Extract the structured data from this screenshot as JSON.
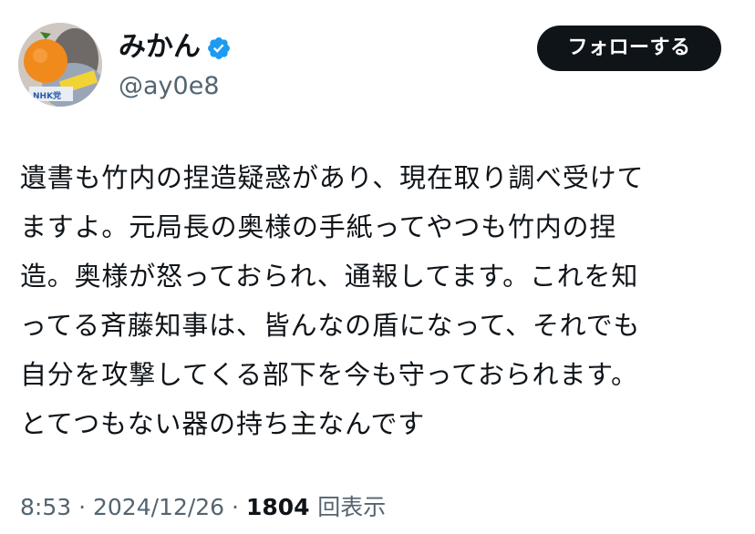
{
  "author": {
    "display_name": "みかん",
    "handle": "@ay0e8",
    "verified": true,
    "avatar_badge_text": "NHK党"
  },
  "follow_button": {
    "label": "フォローする"
  },
  "tweet": {
    "lines": [
      "遺書も竹内の捏造疑惑があり、現在取り調べ受けて",
      "ますよ。元局長の奥様の手紙ってやつも竹内の捏",
      "造。奥様が怒っておられ、通報してます。これを知",
      "ってる斉藤知事は、皆んなの盾になって、それでも",
      "自分を攻撃してくる部下を今も守っておられます。",
      "とてつもない器の持ち主なんです"
    ]
  },
  "meta": {
    "time": "8:53",
    "separator": "·",
    "date": "2024/12/26",
    "views_count": "1804",
    "views_label": "回表示"
  },
  "colors": {
    "text_primary": "#0f1419",
    "text_secondary": "#536471",
    "verified_blue": "#1d9bf0",
    "button_bg": "#0f1419",
    "avatar_orange": "#f08a1c"
  },
  "icons": {
    "verified": "verified-badge-icon"
  }
}
